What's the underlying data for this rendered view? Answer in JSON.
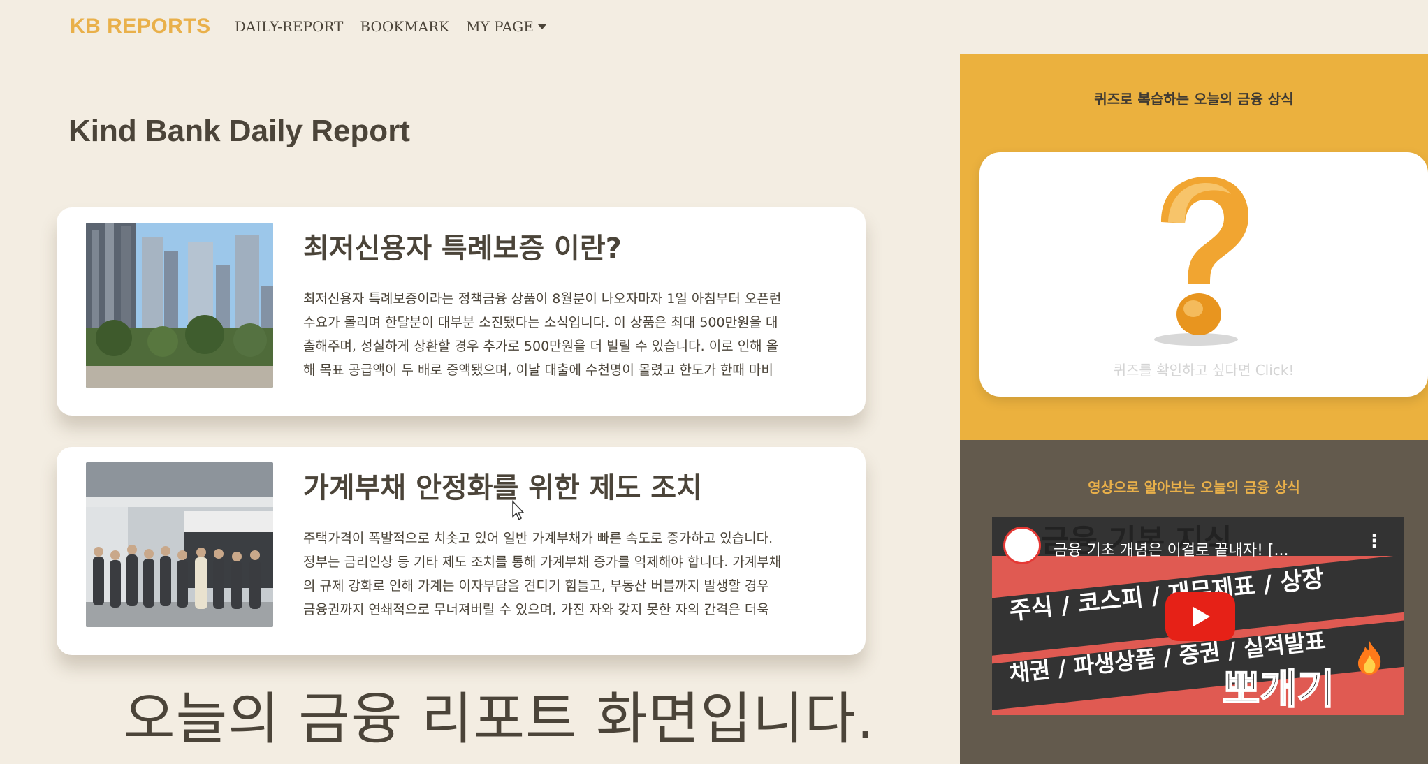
{
  "nav": {
    "brand": "KB REPORTS",
    "links": [
      "DAILY-REPORT",
      "BOOKMARK",
      "MY PAGE"
    ]
  },
  "page_title": "Kind Bank Daily Report",
  "reports": [
    {
      "title": "최저신용자 특례보증 이란?",
      "lines": [
        "최저신용자 특례보증이라는 정책금융 상품이 8월분이 나오자마자 1일 아침부터 오픈런",
        "수요가 몰리며 한달분이 대부분 소진됐다는 소식입니다. 이 상품은 최대 500만원을 대",
        "출해주며, 성실하게 상환할 경우 추가로 500만원을 더 빌릴 수 있습니다. 이로 인해 올",
        "해 목표 공급액이 두 배로 증액됐으며, 이날 대출에 수천명이 몰렸고 한도가 한때 마비"
      ]
    },
    {
      "title": "가계부채 안정화를 위한 제도 조치",
      "lines": [
        "주택가격이 폭발적으로 치솟고 있어 일반 가계부채가 빠른 속도로 증가하고 있습니다.",
        "정부는 금리인상 등 기타 제도 조치를 통해 가계부채 증가를 억제해야 합니다. 가계부채",
        "의 규제 강화로 인해 가계는 이자부담을 견디기 힘들고, 부동산 버블까지 발생할 경우",
        "금융권까지 연쇄적으로 무너져버릴 수 있으며, 가진 자와 갖지 못한 자의 간격은 더욱"
      ]
    }
  ],
  "subtitle": "오늘의 금융 리포트 화면입니다.",
  "quiz": {
    "heading": "퀴즈로 복습하는 오늘의 금융 상식",
    "caption": "퀴즈를 확인하고 싶다면 Click!"
  },
  "video": {
    "heading": "영상으로 알아보는 오늘의 금융 상식",
    "title": "금융 기초 개념은 이걸로 끝내자! [...",
    "thumb_lines": [
      "금융 기본 지식",
      "주식 / 코스피 / 재무제표 / 상장",
      "채권 / 파생상품 / 증권 / 실적발표",
      "뽀개기"
    ]
  },
  "colors": {
    "background": "#f3ede2",
    "brand": "#e9b04a",
    "quiz_panel": "#ebb13e",
    "video_panel": "#635a4d",
    "text": "#4b4439"
  }
}
